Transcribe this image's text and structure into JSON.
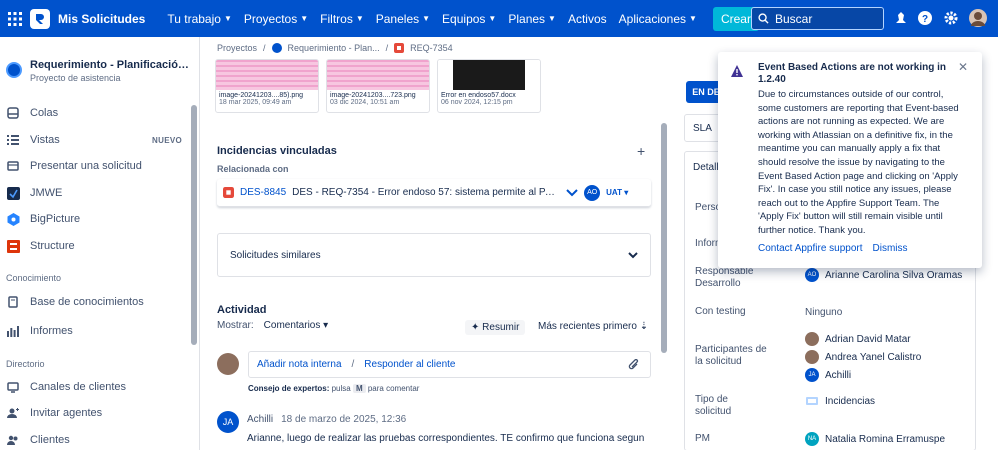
{
  "topnav": {
    "app_title": "Mis Solicitudes",
    "items": [
      "Tu trabajo",
      "Proyectos",
      "Filtros",
      "Paneles",
      "Equipos",
      "Planes",
      "Activos",
      "Aplicaciones"
    ],
    "create_label": "Crear",
    "search_placeholder": "Buscar"
  },
  "sidebar": {
    "project_name": "Requerimiento - Planificación de la D...",
    "project_type": "Proyecto de asistencia",
    "items": [
      {
        "label": "Colas"
      },
      {
        "label": "Vistas",
        "badge": "NUEVO"
      },
      {
        "label": "Presentar una solicitud"
      },
      {
        "label": "JMWE"
      },
      {
        "label": "BigPicture"
      },
      {
        "label": "Structure"
      }
    ],
    "sections": {
      "knowledge": "Conocimiento",
      "directory": "Directorio"
    },
    "knowledge_items": [
      "Base de conocimientos",
      "Informes"
    ],
    "directory_items": [
      "Canales de clientes",
      "Invitar agentes",
      "Clientes"
    ]
  },
  "breadcrumb": [
    "Proyectos",
    "Requerimiento - Plan...",
    "REQ-7354"
  ],
  "attachments": [
    {
      "name": "image-20241203....85).png",
      "date": "18 mar 2025, 09:49 am"
    },
    {
      "name": "image-20241203....723.png",
      "date": "03 dic 2024, 10:51 am"
    },
    {
      "name": "Error en endoso57.docx",
      "date": "06 nov 2024, 12:15 pm"
    }
  ],
  "linked": {
    "title": "Incidencias vinculadas",
    "relation": "Relacionada con",
    "key": "DES-8845",
    "summary": "DES - REQ-7354 - Error endoso 57: sistema permite al PAS elimi...",
    "assignee_initials": "AO",
    "status": "UAT"
  },
  "similar_title": "Solicitudes similares",
  "activity": {
    "title": "Actividad",
    "show_label": "Mostrar:",
    "show_value": "Comentarios",
    "resume": "Resumir",
    "sort": "Más recientes primero",
    "add_internal": "Añadir nota interna",
    "separator": "/",
    "reply": "Responder al cliente",
    "tip_bold": "Consejo de expertos:",
    "tip_mid": "pulsa",
    "tip_key": "M",
    "tip_end": "para comentar",
    "comment": {
      "initials": "JA",
      "author": "Achilli",
      "when": "18 de marzo de 2025, 12:36",
      "text": "Arianne, luego de realizar las pruebas correspondientes. TE confirmo que funciona segun lo"
    }
  },
  "right": {
    "status": "EN DE",
    "sla": "SLA",
    "details": "Detalle",
    "fields": [
      {
        "label": "Perso"
      },
      {
        "label": "Inform"
      },
      {
        "label": "Responsable Desarrollo",
        "value": "Arianne Carolina Silva Oramas",
        "initials": "AO"
      },
      {
        "label": "Con testing",
        "value": "Ninguno"
      },
      {
        "label": "Participantes de la solicitud",
        "values": [
          "Adrian David Matar",
          "Andrea Yanel Calistro",
          "Achilli"
        ]
      },
      {
        "label": "Tipo de solicitud",
        "value": "Incidencias"
      },
      {
        "label": "PM",
        "value": "Natalia Romina Erramuspe",
        "initials": "NA"
      }
    ]
  },
  "notice": {
    "title": "Event Based Actions are not working in 1.2.40",
    "body": "Due to circumstances outside of our control, some customers are reporting that Event-based actions are not running as expected. We are working with Atlassian on a definitive fix, in the meantime you can manually apply a fix that should resolve the issue by navigating to the Event Based Action page and clicking on 'Apply Fix'. In case you still notice any issues, please reach out to the Appfire Support Team. The 'Apply Fix' button will still remain visible until further notice. Thank you.",
    "contact": "Contact Appfire support",
    "dismiss": "Dismiss"
  }
}
